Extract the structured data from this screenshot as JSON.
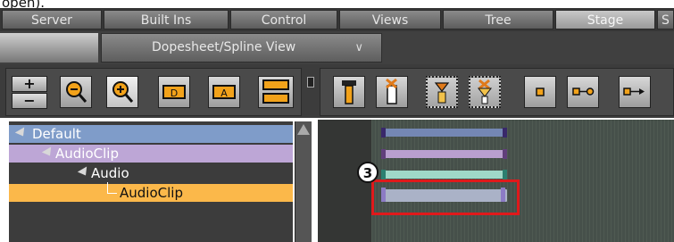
{
  "caption": "open).",
  "tabs": [
    {
      "label": "Server"
    },
    {
      "label": "Built Ins"
    },
    {
      "label": "Control"
    },
    {
      "label": "Views"
    },
    {
      "label": "Tree"
    },
    {
      "label": "Stage",
      "active": true
    },
    {
      "label": "S"
    }
  ],
  "view_selector": {
    "label": "Dopesheet/Spline View",
    "icon": "chevron-down-icon"
  },
  "toolbar_left": [
    {
      "name": "add-button",
      "icon": "plus-icon",
      "label": "+"
    },
    {
      "name": "remove-button",
      "icon": "minus-icon",
      "label": "−"
    },
    {
      "name": "zoom-out-button",
      "icon": "zoom-out-icon"
    },
    {
      "name": "zoom-in-button",
      "icon": "zoom-in-icon"
    },
    {
      "name": "add-director-button",
      "icon": "add-director-icon",
      "label": "D"
    },
    {
      "name": "add-actor-button",
      "icon": "add-actor-icon",
      "label": "A"
    },
    {
      "name": "expand-collapse-button",
      "icon": "expand-collapse-icon"
    }
  ],
  "toolbar_right": [
    {
      "name": "set-key-button",
      "icon": "key-icon"
    },
    {
      "name": "delete-key-button",
      "icon": "delete-key-icon"
    },
    {
      "name": "set-keyframe-button",
      "icon": "keyframe-icon"
    },
    {
      "name": "delete-keyframe-button",
      "icon": "delete-keyframe-icon"
    },
    {
      "name": "single-point-button",
      "icon": "point-icon"
    },
    {
      "name": "ease-button",
      "icon": "ease-icon"
    },
    {
      "name": "linear-button",
      "icon": "linear-icon"
    }
  ],
  "tree": [
    {
      "label": "Default",
      "indent": 0,
      "bg": "#7f9cc9"
    },
    {
      "label": "AudioClip",
      "indent": 1,
      "bg": "#bda6d6"
    },
    {
      "label": "Audio",
      "indent": 2,
      "bg": "#3c3c3c"
    },
    {
      "label": "AudioClip",
      "indent": 3,
      "bg": "#fbb84a",
      "selected": true
    }
  ],
  "timeline": {
    "tracks": [
      {
        "color": "#7487b4",
        "cap": "#39286a"
      },
      {
        "color": "#b99fcf",
        "cap": "#613f7b"
      },
      {
        "color": "#9fd8c8",
        "cap": "#2b7f70"
      },
      {
        "color": "#aab2c7",
        "cap": "#8c7bc5"
      }
    ],
    "callout": "3"
  },
  "colors": {
    "highlight": "#e0191b"
  }
}
